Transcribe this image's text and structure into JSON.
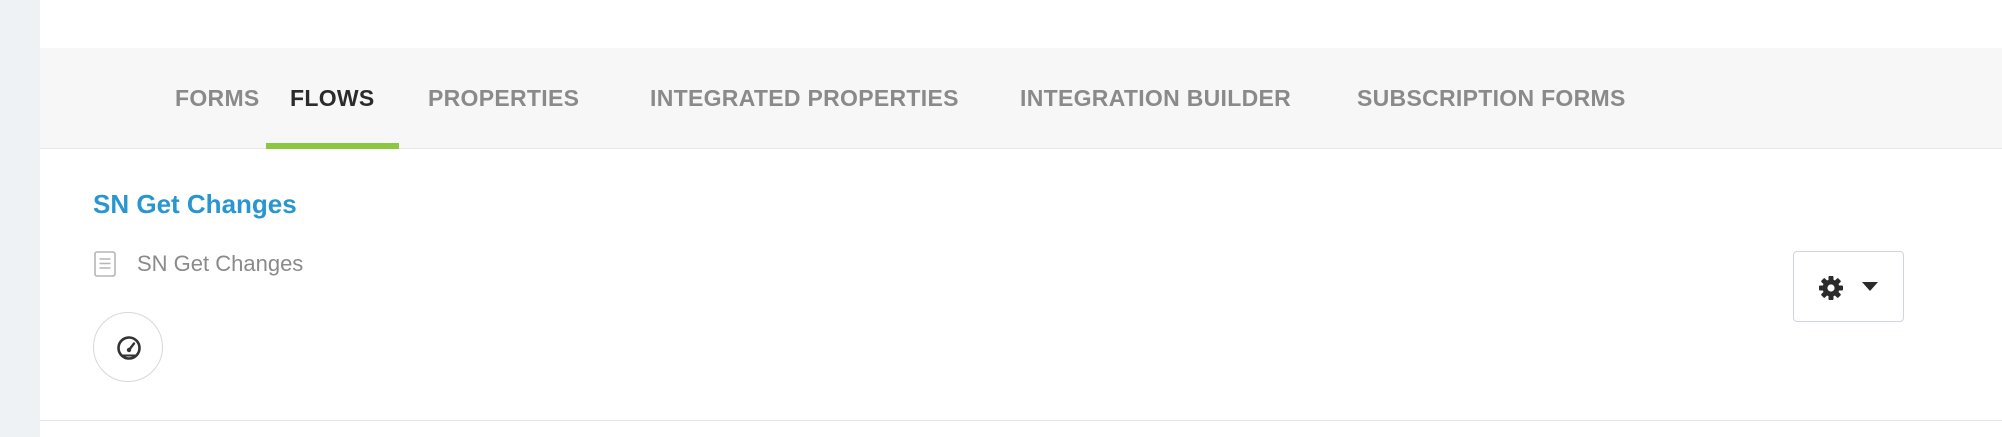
{
  "tabs": [
    {
      "label": "FORMS",
      "active": false
    },
    {
      "label": "FLOWS",
      "active": true
    },
    {
      "label": "PROPERTIES",
      "active": false
    },
    {
      "label": "INTEGRATED PROPERTIES",
      "active": false
    },
    {
      "label": "INTEGRATION BUILDER",
      "active": false
    },
    {
      "label": "SUBSCRIPTION FORMS",
      "active": false
    }
  ],
  "flow": {
    "title": "SN Get Changes",
    "description": "SN Get Changes"
  },
  "icons": {
    "document": "document-icon",
    "dashboard": "dashboard-gauge-icon",
    "settings": "gear-icon",
    "caret": "caret-down-icon"
  },
  "colors": {
    "active_tab_underline": "#8dc63f",
    "link": "#2896cf",
    "inactive_tab_text": "#8a8a8a",
    "active_tab_text": "#2b2b2b"
  }
}
